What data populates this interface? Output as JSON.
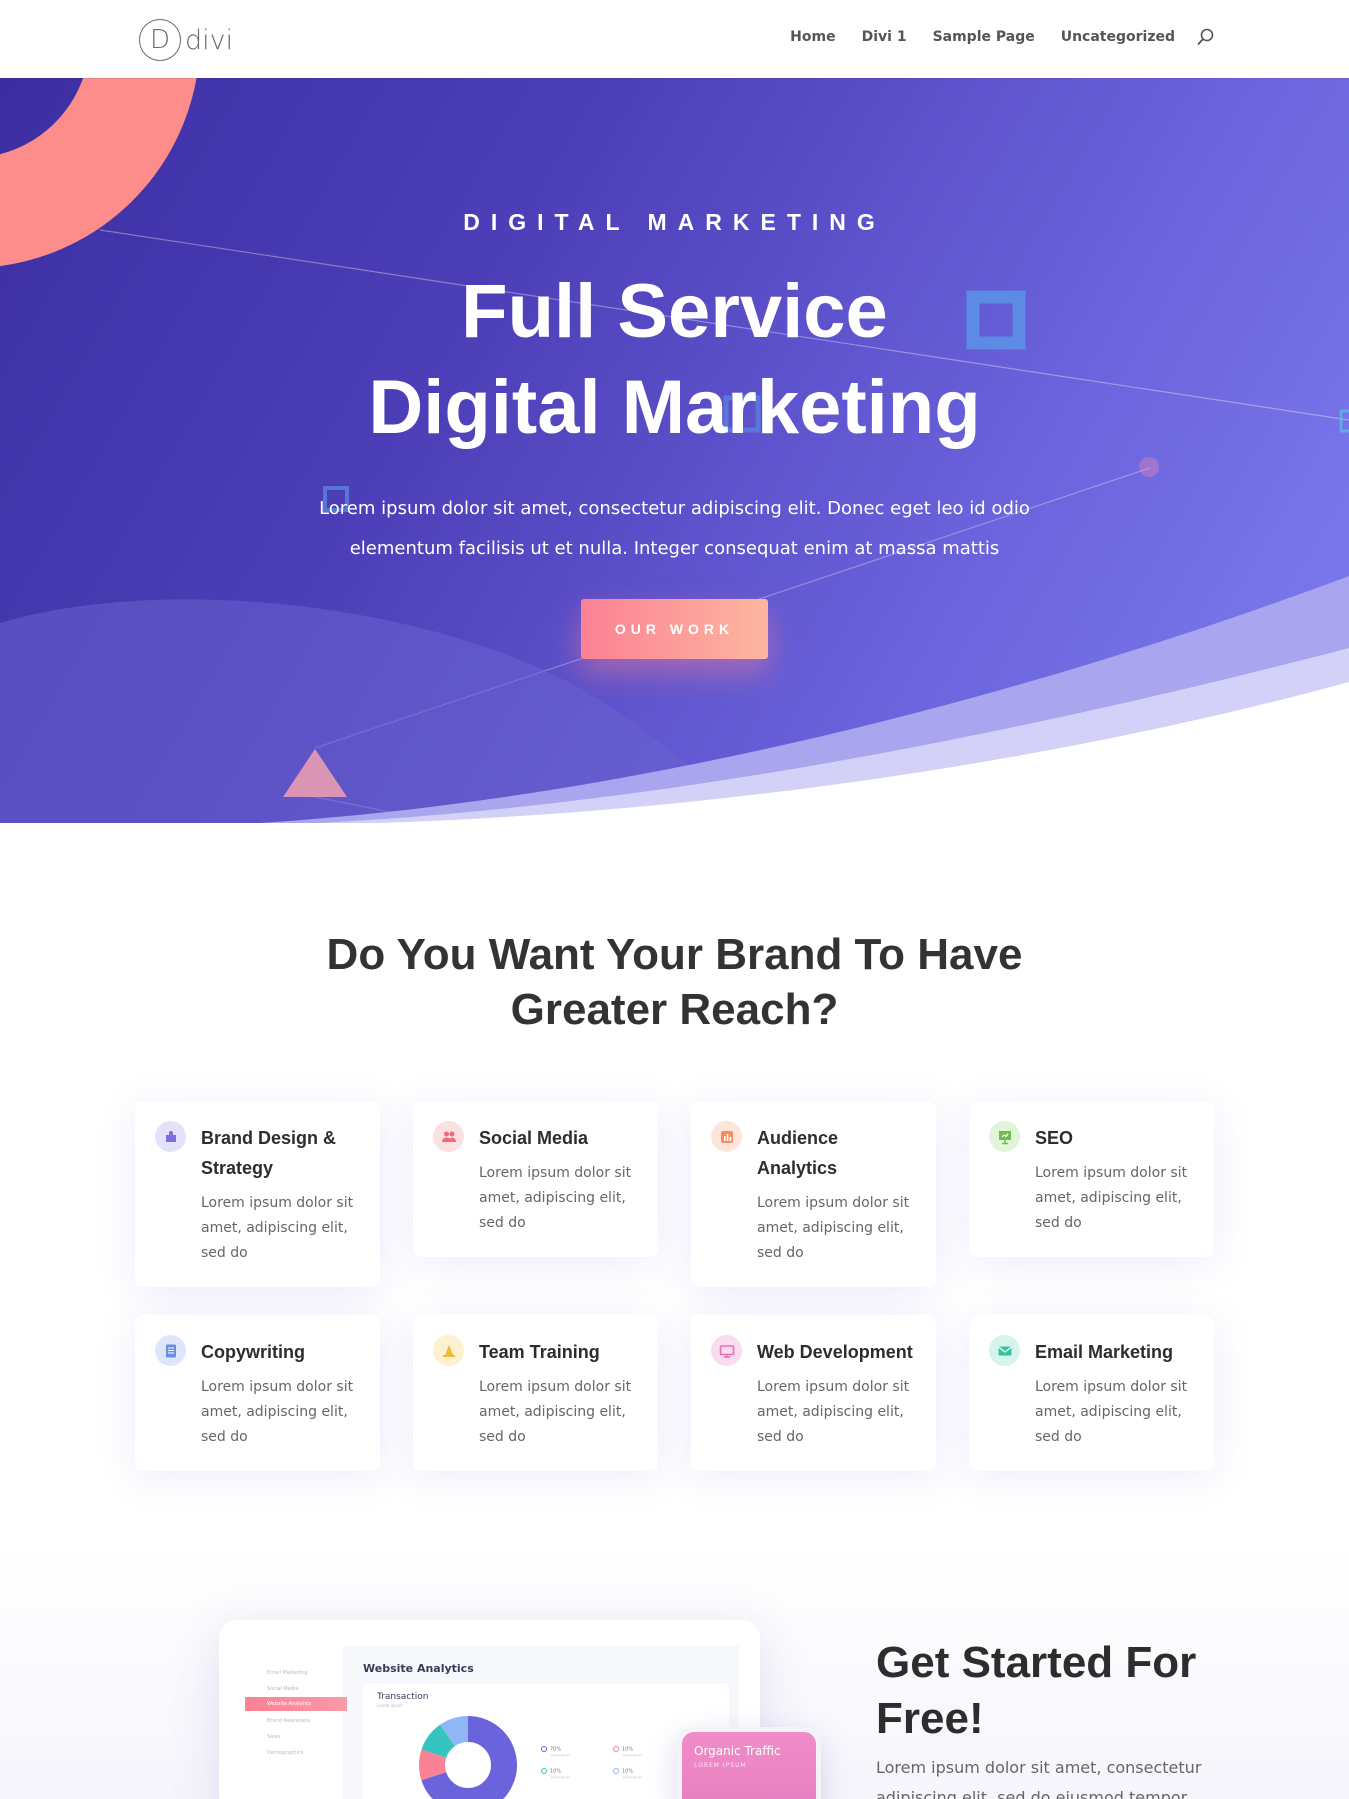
{
  "header": {
    "logo_text": "divi",
    "logo_letter": "D",
    "nav": [
      "Home",
      "Divi 1",
      "Sample Page",
      "Uncategorized"
    ]
  },
  "hero": {
    "eyebrow": "DIGITAL MARKETING",
    "title_line1": "Full Service",
    "title_line2": "Digital Marketing",
    "description": "Lorem ipsum dolor sit amet, consectetur adipiscing elit. Donec eget leo id odio elementum facilisis ut et nulla. Integer consequat enim at massa mattis",
    "button_label": "OUR WORK"
  },
  "reach": {
    "title_line1": "Do You Want Your Brand To Have",
    "title_line2": "Greater Reach?",
    "cards": [
      {
        "title": "Brand Design & Strategy",
        "text": "Lorem ipsum dolor sit amet, adipiscing elit, sed do",
        "icon": "puzzle-icon",
        "color": "#7b6fe0",
        "bg": "#e4e1fb"
      },
      {
        "title": "Social Media",
        "text": "Lorem ipsum dolor sit amet, adipiscing elit, sed do",
        "icon": "users-icon",
        "color": "#f06a7a",
        "bg": "#fde0e3"
      },
      {
        "title": "Audience Analytics",
        "text": "Lorem ipsum dolor sit amet, adipiscing elit, sed do",
        "icon": "bar-chart-icon",
        "color": "#f68b5c",
        "bg": "#fee5d9"
      },
      {
        "title": "SEO",
        "text": "Lorem ipsum dolor sit amet,  adipiscing elit, sed do",
        "icon": "presentation-icon",
        "color": "#6cc04a",
        "bg": "#e2f5d8"
      },
      {
        "title": "Copywriting",
        "text": "Lorem ipsum dolor sit amet, adipiscing elit, sed do",
        "icon": "document-icon",
        "color": "#6a8fe0",
        "bg": "#dde6fb"
      },
      {
        "title": "Team Training",
        "text": "Lorem ipsum dolor sit amet, adipiscing elit, sed do",
        "icon": "cone-icon",
        "color": "#f2b935",
        "bg": "#fdf1cf"
      },
      {
        "title": "Web Development",
        "text": "Lorem ipsum dolor sit amet, adipiscing elit, sed do",
        "icon": "monitor-icon",
        "color": "#e86fb5",
        "bg": "#fbdcee"
      },
      {
        "title": "Email Marketing",
        "text": "Lorem ipsum dolor sit amet,  adipiscing elit, sed do",
        "icon": "envelope-icon",
        "color": "#35c4a0",
        "bg": "#d6f4ec"
      }
    ]
  },
  "dashboard": {
    "title": "Website Analytics",
    "sidebar": [
      "Email Marketing",
      "Social Media",
      "Website Analytics",
      "Brand Awareness",
      "Sales",
      "Demographics"
    ],
    "active_index": 2,
    "panel_title": "Transaction",
    "panel_sub": "Lorem ipsum",
    "legend": [
      {
        "value": "70%",
        "sub": "Lorem ipsum",
        "color": "#6b63dc"
      },
      {
        "value": "10%",
        "sub": "Lorem ipsum",
        "color": "#fb8194"
      },
      {
        "value": "10%",
        "sub": "Lorem ipsum",
        "color": "#35c4c0"
      },
      {
        "value": "10%",
        "sub": "Lorem ipsum",
        "color": "#8fb6f5"
      }
    ],
    "phone_title": "Organic Traffic",
    "phone_sub": "LOREM IPSUM"
  },
  "get_started": {
    "title_line1": "Get Started For",
    "title_line2": "Free!",
    "text": "Lorem ipsum dolor sit amet, consectetur adipiscing elit, sed do eiusmod tempor"
  }
}
